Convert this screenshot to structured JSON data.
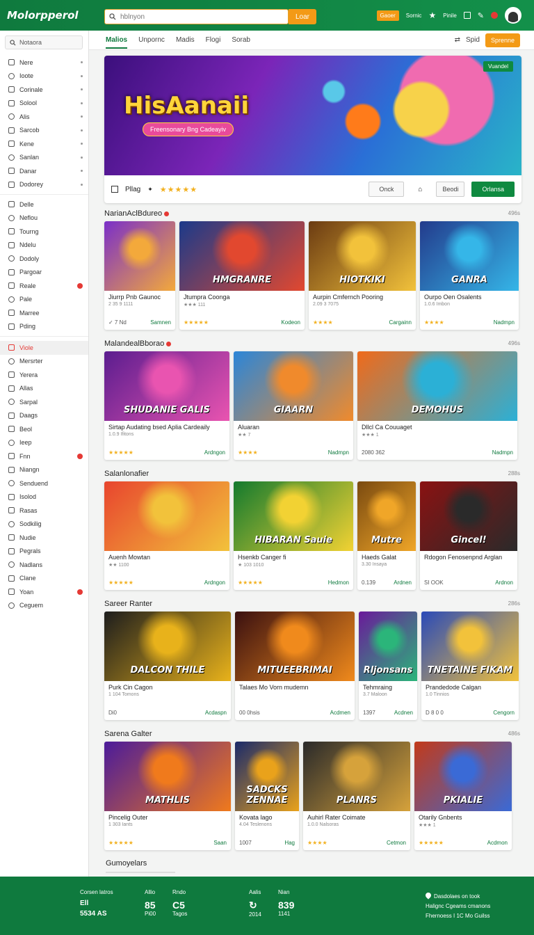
{
  "header": {
    "logo": "Molorpperol",
    "search_placeholder": "hblnyon",
    "search_button": "Loar",
    "chip": "Gaoer",
    "link1": "Sornic",
    "link2": "Pinile"
  },
  "sidebar": {
    "search": "Notaora",
    "group1": [
      "Nere",
      "Ioote",
      "Corinale",
      "Solool",
      "Alis",
      "Sarcob",
      "Kene",
      "Sanlan",
      "Danar",
      "Dodorey"
    ],
    "group2": [
      "Delle",
      "Neflou",
      "Tourng",
      "Ndelu",
      "Dodoly",
      "Pargoar",
      "Reale",
      "Pale",
      "Marree",
      "Pding"
    ],
    "group3": [
      "Viole",
      "Mersrter",
      "Yerera",
      "Allas",
      "Sarpal",
      "Daags",
      "Beol",
      "Ieep",
      "Fnn",
      "Niangn",
      "Senduend",
      "Isolod",
      "Rasas",
      "Sodkilig",
      "Nudie",
      "Pegrals",
      "Nadlans",
      "Clane",
      "Yoan",
      "Ceguem"
    ]
  },
  "tabs": {
    "items": [
      "Malios",
      "Unpornc",
      "Madis",
      "Flogi",
      "Sorab"
    ],
    "right_link": "Spid",
    "right_button": "Sprenne"
  },
  "hero": {
    "title": "HisAanaii",
    "subtitle": "Freensonary Bng Cadeayiv",
    "badge": "Vuandel",
    "play_label": "Pllag",
    "rating": "★★★★★",
    "btn1": "Onck",
    "btn2": "Beodi",
    "btn3": "Orlansa"
  },
  "sections": [
    {
      "title": "NarianAclBdureo",
      "count": "496s",
      "cards": [
        {
          "caption": "",
          "name": "Jiurrp Pnb Gaunoc",
          "meta": "2 35 9 1111",
          "foot_left": "✓ 7 Nd",
          "action": "Samnen"
        },
        {
          "caption": "HMGRANRE",
          "name": "Jtumpra Coonga",
          "meta": "★★★ 111",
          "foot_left": "★★★★★",
          "action": "Kodeon"
        },
        {
          "caption": "HIOTKIKI",
          "name": "Aurpin Cmfernch Pooring",
          "meta": "2.09 3 7075",
          "foot_left": "★★★★",
          "action": "Cargainn"
        },
        {
          "caption": "GANRA",
          "name": "Ourpo Oen Osalents",
          "meta": "1.0.6 Imbon",
          "foot_left": "★★★★",
          "action": "Nadmpn"
        }
      ]
    },
    {
      "title": "MalandealBborao",
      "count": "496s",
      "cards": [
        {
          "caption": "SHUDANIE GALIS",
          "name": "Sirtap Audating bsed Aplia Cardeaily",
          "meta": "1.0.9 Ifitons",
          "foot_left": "★★★★★",
          "action": "Ardngon"
        },
        {
          "caption": "GIAARN",
          "name": "Aluaran",
          "meta": "★★ 7",
          "foot_left": "★★★★",
          "action": "Nadmpn"
        },
        {
          "caption": "DEMOHUS",
          "name": "Dllcl Ca Couuaget",
          "meta": "★★★ 1",
          "foot_left": "2080 362",
          "action": "Nadmpn"
        }
      ]
    },
    {
      "title": "Salanlonafier",
      "count": "288s",
      "cards": [
        {
          "caption": "",
          "name": "Auenh Mowtan",
          "meta": "★★ 1100",
          "foot_left": "★★★★★",
          "action": "Ardngon"
        },
        {
          "caption": "HIBARAN Sauie",
          "name": "Hsenkb Canger fi",
          "meta": "★ 103 1010",
          "foot_left": "★★★★★",
          "action": "Hedmon"
        },
        {
          "caption": "Mutre",
          "name": "Haeds Galat",
          "meta": "3.30 Insaya",
          "foot_left": "0.139",
          "action": "Ardnen"
        },
        {
          "caption": "Gincel!",
          "name": "Rdogon Fenosenpnd Arglan",
          "meta": "",
          "foot_left": "SI OOK",
          "action": "Ardnon"
        }
      ]
    },
    {
      "title": "Sareer Ranter",
      "count": "286s",
      "cards": [
        {
          "caption": "DALCON THILE",
          "name": "Purk Cin Cagon",
          "meta": "1 104 Tomons",
          "foot_left": "Di0",
          "action": "Acdaspn"
        },
        {
          "caption": "MITUEEBRIMAI",
          "name": "Talaes Mo Vorn mudemn",
          "meta": "",
          "foot_left": "00 0hsis",
          "action": "Acdmen"
        },
        {
          "caption": "Rljonsans",
          "name": "Tehmraing",
          "meta": "3.7 Maloon",
          "foot_left": "1397",
          "action": "Acdnen"
        },
        {
          "caption": "TNETAINE FIKAM",
          "name": "Prandedode Calgan",
          "meta": "1.0 Tinnios",
          "foot_left": "D 8 0 0",
          "action": "Cengorn"
        }
      ]
    },
    {
      "title": "Sarena Galter",
      "count": "486s",
      "cards": [
        {
          "caption": "MATHLIS",
          "name": "Pincelig Outer",
          "meta": "1 303 Iants",
          "foot_left": "★★★★★",
          "action": "Saan"
        },
        {
          "caption": "SADCKS ZENNAE",
          "name": "Kovata lago",
          "meta": "4.04 Teslenons",
          "foot_left": "1007",
          "action": "Hag"
        },
        {
          "caption": "PLANRS",
          "name": "Auhirl Rater Coimate",
          "meta": "1.0.0 Nalsoras",
          "foot_left": "★★★★",
          "action": "Cetmon"
        },
        {
          "caption": "PKIALIE",
          "name": "Otarily Gnbents",
          "meta": "★★★ 1",
          "foot_left": "★★★★★",
          "action": "Acdmon"
        }
      ]
    }
  ],
  "bottom_section": "Gumoyelars",
  "footer": {
    "c1_label": "Corsen latros",
    "c1_a": "Ell",
    "c1_b": "5534 AS",
    "c2_label": "Allio",
    "c2_a": "85",
    "c2_b": "Pi00",
    "c3_label": "Rndo",
    "c3_a": "C5",
    "c3_b": "Tagos",
    "c4_label": "Aalis",
    "c4_b": "2014",
    "c5_label": "Nian",
    "c5_a": "839",
    "c5_b": "1141",
    "right_title": "Dasdolaes on took",
    "right_l2": "Halignc Cgeams  cmanons",
    "right_l3": "Fhernoess I 1C Mo Guilss"
  },
  "colors": {
    "brand": "#0f7a3e",
    "accent": "#f39a16",
    "alert": "#e53935"
  }
}
